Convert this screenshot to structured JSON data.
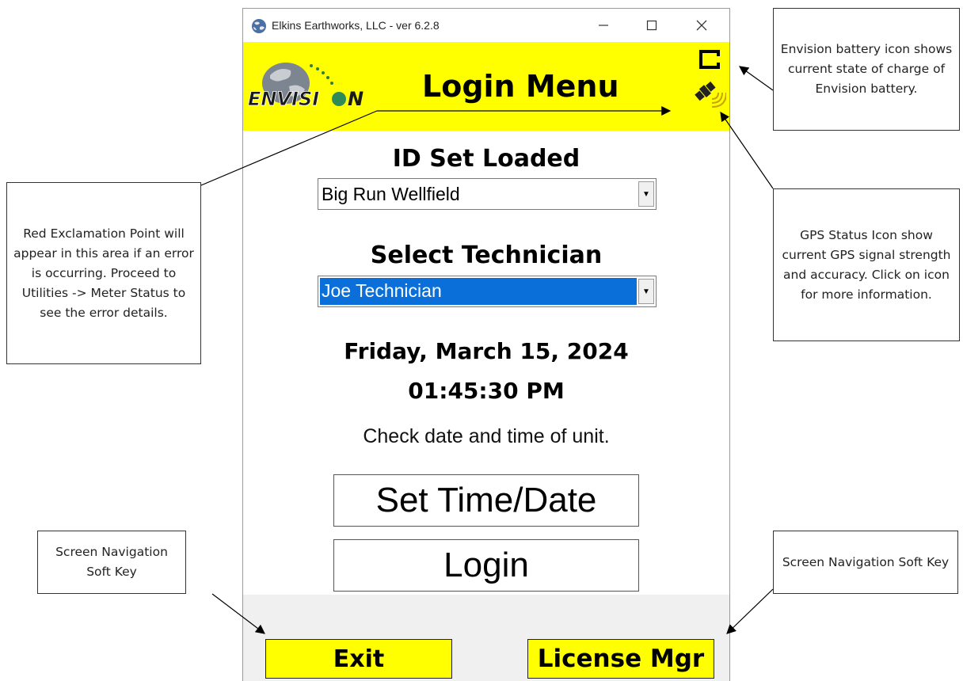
{
  "window": {
    "title": "Elkins Earthworks, LLC - ver 6.2.8",
    "controls": {
      "minimize": "—",
      "maximize": "☐",
      "close": "✕"
    }
  },
  "header": {
    "logo_text": "ENVISI●N",
    "title": "Login Menu",
    "battery_icon": "battery-icon",
    "gps_icon": "gps-satellite-icon"
  },
  "main": {
    "id_set_label": "ID Set Loaded",
    "id_set_value": "Big Run Wellfield",
    "technician_label": "Select Technician",
    "technician_value": "Joe Technician",
    "date": "Friday, March 15, 2024",
    "time": "01:45:30 PM",
    "check_note": "Check date and time of unit.",
    "set_time_button": "Set Time/Date",
    "login_button": "Login"
  },
  "footer": {
    "exit_button": "Exit",
    "license_button": "License Mgr"
  },
  "callouts": {
    "battery": "Envision battery icon shows current state of charge of Envision battery.",
    "gps": "GPS Status Icon show current GPS signal strength and accuracy.  Click on icon for more information.",
    "error": "Red Exclamation Point will appear in this area if an error is occurring.  Proceed to Utilities -> Meter Status to see the error details.",
    "nav_left": "Screen Navigation Soft Key",
    "nav_right": "Screen Navigation Soft Key"
  },
  "colors": {
    "header_bg": "#ffff00",
    "soft_key_bg": "#ffff00",
    "selection": "#0a6fd8",
    "footer_bg": "#f0f0f0"
  }
}
